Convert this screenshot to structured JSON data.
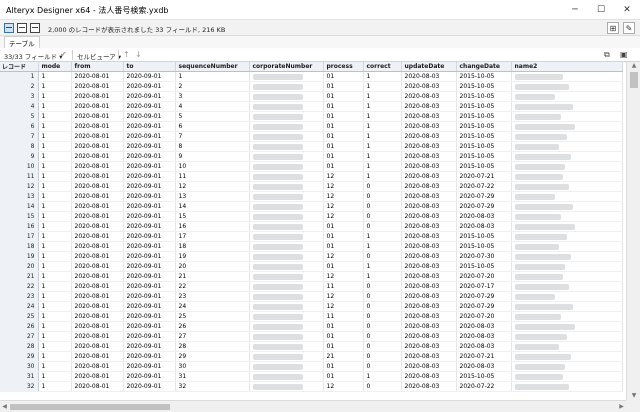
{
  "window": {
    "title": "Alteryx Designer x64 - 法人番号検索.yxdb",
    "min_glyph": "─",
    "max_glyph": "☐",
    "close_glyph": "✕"
  },
  "infobar": {
    "text": "2,000 のレコードが表示されました 33 フィールド, 216 KB"
  },
  "tab": {
    "label": "テーブル"
  },
  "toolbar": {
    "field_count": "33/33 フィールド",
    "field_arrow": "▾",
    "check_glyph": "✔",
    "cell_viewer": "セルビューア",
    "cell_arrow": "▾",
    "up_glyph": "↑",
    "down_glyph": "↓"
  },
  "table": {
    "columns": [
      "レコード",
      "mode",
      "from",
      "to",
      "sequenceNumber",
      "corporateNumber",
      "process",
      "correct",
      "updateDate",
      "changeDate",
      "name2"
    ],
    "rows": [
      {
        "n": "1",
        "mode": "1",
        "from": "2020-08-01",
        "to": "2020-09-01",
        "seq": "1",
        "process": "01",
        "correct": "1",
        "update": "2020-08-03",
        "change": "2015-10-05"
      },
      {
        "n": "2",
        "mode": "1",
        "from": "2020-08-01",
        "to": "2020-09-01",
        "seq": "2",
        "process": "01",
        "correct": "1",
        "update": "2020-08-03",
        "change": "2015-10-05"
      },
      {
        "n": "3",
        "mode": "1",
        "from": "2020-08-01",
        "to": "2020-09-01",
        "seq": "3",
        "process": "01",
        "correct": "1",
        "update": "2020-08-03",
        "change": "2015-10-05"
      },
      {
        "n": "4",
        "mode": "1",
        "from": "2020-08-01",
        "to": "2020-09-01",
        "seq": "4",
        "process": "01",
        "correct": "1",
        "update": "2020-08-03",
        "change": "2015-10-05"
      },
      {
        "n": "5",
        "mode": "1",
        "from": "2020-08-01",
        "to": "2020-09-01",
        "seq": "5",
        "process": "01",
        "correct": "1",
        "update": "2020-08-03",
        "change": "2015-10-05"
      },
      {
        "n": "6",
        "mode": "1",
        "from": "2020-08-01",
        "to": "2020-09-01",
        "seq": "6",
        "process": "01",
        "correct": "1",
        "update": "2020-08-03",
        "change": "2015-10-05"
      },
      {
        "n": "7",
        "mode": "1",
        "from": "2020-08-01",
        "to": "2020-09-01",
        "seq": "7",
        "process": "01",
        "correct": "1",
        "update": "2020-08-03",
        "change": "2015-10-05"
      },
      {
        "n": "8",
        "mode": "1",
        "from": "2020-08-01",
        "to": "2020-09-01",
        "seq": "8",
        "process": "01",
        "correct": "1",
        "update": "2020-08-03",
        "change": "2015-10-05"
      },
      {
        "n": "9",
        "mode": "1",
        "from": "2020-08-01",
        "to": "2020-09-01",
        "seq": "9",
        "process": "01",
        "correct": "1",
        "update": "2020-08-03",
        "change": "2015-10-05"
      },
      {
        "n": "10",
        "mode": "1",
        "from": "2020-08-01",
        "to": "2020-09-01",
        "seq": "10",
        "process": "01",
        "correct": "1",
        "update": "2020-08-03",
        "change": "2015-10-05"
      },
      {
        "n": "11",
        "mode": "1",
        "from": "2020-08-01",
        "to": "2020-09-01",
        "seq": "11",
        "process": "12",
        "correct": "1",
        "update": "2020-08-03",
        "change": "2020-07-21"
      },
      {
        "n": "12",
        "mode": "1",
        "from": "2020-08-01",
        "to": "2020-09-01",
        "seq": "12",
        "process": "12",
        "correct": "0",
        "update": "2020-08-03",
        "change": "2020-07-22"
      },
      {
        "n": "13",
        "mode": "1",
        "from": "2020-08-01",
        "to": "2020-09-01",
        "seq": "13",
        "process": "12",
        "correct": "0",
        "update": "2020-08-03",
        "change": "2020-07-29"
      },
      {
        "n": "14",
        "mode": "1",
        "from": "2020-08-01",
        "to": "2020-09-01",
        "seq": "14",
        "process": "12",
        "correct": "0",
        "update": "2020-08-03",
        "change": "2020-07-29"
      },
      {
        "n": "15",
        "mode": "1",
        "from": "2020-08-01",
        "to": "2020-09-01",
        "seq": "15",
        "process": "12",
        "correct": "0",
        "update": "2020-08-03",
        "change": "2020-08-03"
      },
      {
        "n": "16",
        "mode": "1",
        "from": "2020-08-01",
        "to": "2020-09-01",
        "seq": "16",
        "process": "01",
        "correct": "0",
        "update": "2020-08-03",
        "change": "2020-08-03"
      },
      {
        "n": "17",
        "mode": "1",
        "from": "2020-08-01",
        "to": "2020-09-01",
        "seq": "17",
        "process": "01",
        "correct": "1",
        "update": "2020-08-03",
        "change": "2015-10-05"
      },
      {
        "n": "18",
        "mode": "1",
        "from": "2020-08-01",
        "to": "2020-09-01",
        "seq": "18",
        "process": "01",
        "correct": "1",
        "update": "2020-08-03",
        "change": "2015-10-05"
      },
      {
        "n": "19",
        "mode": "1",
        "from": "2020-08-01",
        "to": "2020-09-01",
        "seq": "19",
        "process": "12",
        "correct": "0",
        "update": "2020-08-03",
        "change": "2020-07-30"
      },
      {
        "n": "20",
        "mode": "1",
        "from": "2020-08-01",
        "to": "2020-09-01",
        "seq": "20",
        "process": "01",
        "correct": "1",
        "update": "2020-08-03",
        "change": "2015-10-05"
      },
      {
        "n": "21",
        "mode": "1",
        "from": "2020-08-01",
        "to": "2020-09-01",
        "seq": "21",
        "process": "12",
        "correct": "1",
        "update": "2020-08-03",
        "change": "2020-07-20"
      },
      {
        "n": "22",
        "mode": "1",
        "from": "2020-08-01",
        "to": "2020-09-01",
        "seq": "22",
        "process": "11",
        "correct": "0",
        "update": "2020-08-03",
        "change": "2020-07-17"
      },
      {
        "n": "23",
        "mode": "1",
        "from": "2020-08-01",
        "to": "2020-09-01",
        "seq": "23",
        "process": "12",
        "correct": "0",
        "update": "2020-08-03",
        "change": "2020-07-29"
      },
      {
        "n": "24",
        "mode": "1",
        "from": "2020-08-01",
        "to": "2020-09-01",
        "seq": "24",
        "process": "12",
        "correct": "0",
        "update": "2020-08-03",
        "change": "2020-07-29"
      },
      {
        "n": "25",
        "mode": "1",
        "from": "2020-08-01",
        "to": "2020-09-01",
        "seq": "25",
        "process": "11",
        "correct": "0",
        "update": "2020-08-03",
        "change": "2020-07-20"
      },
      {
        "n": "26",
        "mode": "1",
        "from": "2020-08-01",
        "to": "2020-09-01",
        "seq": "26",
        "process": "01",
        "correct": "0",
        "update": "2020-08-03",
        "change": "2020-08-03"
      },
      {
        "n": "27",
        "mode": "1",
        "from": "2020-08-01",
        "to": "2020-09-01",
        "seq": "27",
        "process": "01",
        "correct": "0",
        "update": "2020-08-03",
        "change": "2020-08-03"
      },
      {
        "n": "28",
        "mode": "1",
        "from": "2020-08-01",
        "to": "2020-09-01",
        "seq": "28",
        "process": "01",
        "correct": "0",
        "update": "2020-08-03",
        "change": "2020-08-03"
      },
      {
        "n": "29",
        "mode": "1",
        "from": "2020-08-01",
        "to": "2020-09-01",
        "seq": "29",
        "process": "21",
        "correct": "0",
        "update": "2020-08-03",
        "change": "2020-07-21"
      },
      {
        "n": "30",
        "mode": "1",
        "from": "2020-08-01",
        "to": "2020-09-01",
        "seq": "30",
        "process": "01",
        "correct": "0",
        "update": "2020-08-03",
        "change": "2020-08-03"
      },
      {
        "n": "31",
        "mode": "1",
        "from": "2020-08-01",
        "to": "2020-09-01",
        "seq": "31",
        "process": "01",
        "correct": "1",
        "update": "2020-08-03",
        "change": "2015-10-05"
      },
      {
        "n": "32",
        "mode": "1",
        "from": "2020-08-01",
        "to": "2020-09-01",
        "seq": "32",
        "process": "12",
        "correct": "0",
        "update": "2020-08-03",
        "change": "2020-07-22"
      }
    ]
  },
  "colors": {
    "header_bg": "#eef1f5",
    "redacted": "#d9dbde",
    "accent": "#3b6ea5"
  }
}
